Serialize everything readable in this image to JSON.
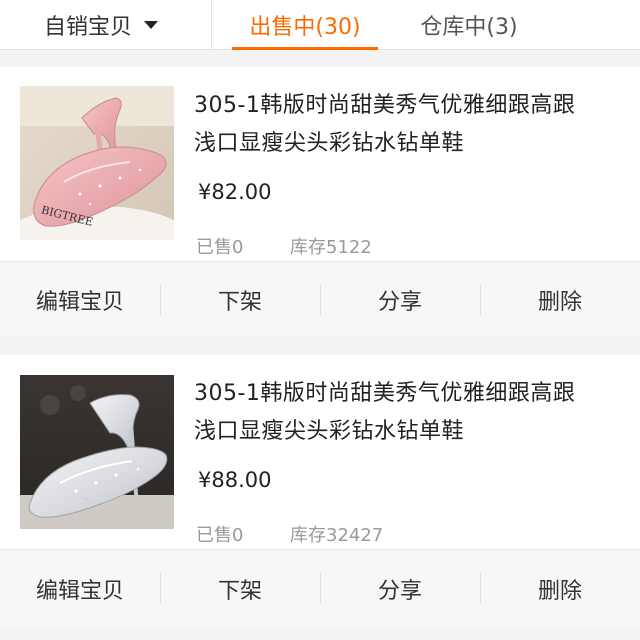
{
  "header": {
    "filter_label": "自销宝贝",
    "tabs": [
      {
        "label": "出售中(30)",
        "active": true
      },
      {
        "label": "仓库中(3)",
        "active": false
      }
    ]
  },
  "products": [
    {
      "title_line1": "305-1韩版时尚甜美秀气优雅细跟高跟",
      "title_line2": "浅口显瘦尖头彩钻水钻单鞋",
      "price": "¥82.00",
      "sold": "已售0",
      "stock": "库存5122",
      "image_brand": "BIGTREE",
      "actions": [
        "编辑宝贝",
        "下架",
        "分享",
        "删除"
      ]
    },
    {
      "title_line1": "305-1韩版时尚甜美秀气优雅细跟高跟",
      "title_line2": "浅口显瘦尖头彩钻水钻单鞋",
      "price": "¥88.00",
      "sold": "已售0",
      "stock": "库存32427",
      "actions": [
        "编辑宝贝",
        "下架",
        "分享",
        "删除"
      ]
    }
  ],
  "colors": {
    "accent": "#ff6a00",
    "background": "#f3f3f3",
    "muted_text": "#9a9a9a"
  }
}
